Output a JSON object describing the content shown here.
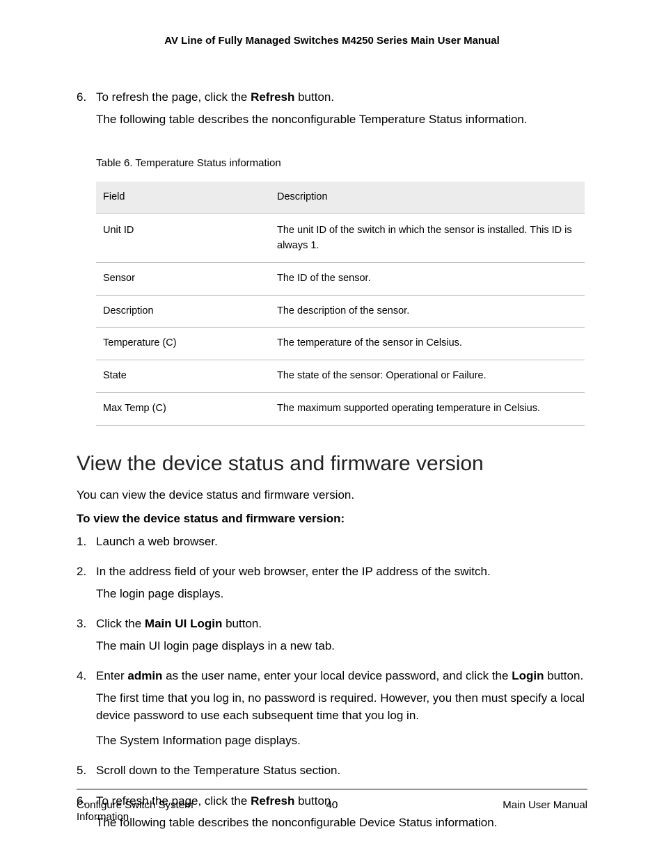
{
  "header": "AV Line of Fully Managed Switches M4250 Series Main User Manual",
  "topStep": {
    "number": "6.",
    "line1a": "To refresh the page, click the ",
    "line1bold": "Refresh",
    "line1b": " button.",
    "line2": "The following table describes the nonconfigurable Temperature Status information."
  },
  "tableCaption": "Table 6. Temperature Status information",
  "tableHeaders": {
    "field": "Field",
    "description": "Description"
  },
  "tableRows": [
    {
      "field": "Unit ID",
      "desc": "The unit ID of the switch in which the sensor is installed. This ID is always 1."
    },
    {
      "field": "Sensor",
      "desc": "The ID of the sensor."
    },
    {
      "field": "Description",
      "desc": "The description of the sensor."
    },
    {
      "field": "Temperature (C)",
      "desc": "The temperature of the sensor in Celsius."
    },
    {
      "field": "State",
      "desc": "The state of the sensor: Operational or Failure."
    },
    {
      "field": "Max Temp (C)",
      "desc": "The maximum supported operating temperature in Celsius."
    }
  ],
  "section": {
    "title": "View the device status and firmware version",
    "intro": "You can view the device status and firmware version.",
    "lead": "To view the device status and firmware version:",
    "steps": [
      {
        "num": "1.",
        "parts": [
          {
            "t": "Launch a web browser."
          }
        ]
      },
      {
        "num": "2.",
        "parts": [
          {
            "t": "In the address field of your web browser, enter the IP address of the switch."
          },
          {
            "t": "The login page displays."
          }
        ]
      },
      {
        "num": "3.",
        "parts": [
          {
            "pre": "Click the ",
            "bold": "Main UI Login",
            "post": " button."
          },
          {
            "t": "The main UI login page displays in a new tab."
          }
        ]
      },
      {
        "num": "4.",
        "parts": [
          {
            "pre": "Enter ",
            "bold": "admin",
            "mid": " as the user name, enter your local device password, and click the ",
            "bold2": "Login",
            "post": " button."
          },
          {
            "t": "The first time that you log in, no password is required. However, you then must specify a local device password to use each subsequent time that you log in."
          },
          {
            "t": "The System Information page displays.",
            "gap": true
          }
        ]
      },
      {
        "num": "5.",
        "parts": [
          {
            "t": "Scroll down to the Temperature Status section."
          }
        ]
      },
      {
        "num": "6.",
        "parts": [
          {
            "pre": "To refresh the page, click the ",
            "bold": "Refresh",
            "post": " button."
          },
          {
            "t": "The following table describes the nonconfigurable Device Status information."
          }
        ]
      }
    ]
  },
  "footer": {
    "left": "Configure Switch System Information",
    "center": "40",
    "right": "Main User Manual"
  }
}
